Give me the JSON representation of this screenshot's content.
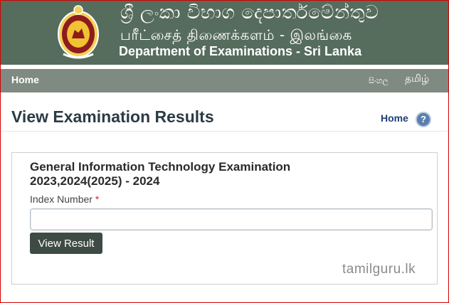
{
  "header": {
    "title_sinhala": "ශ්‍රී ලංකා විභාග දෙපාර්තමේන්තුව",
    "title_tamil": "பரீட்சைத் திணைக்களம் - இலங்கை",
    "title_english": "Department of Examinations - Sri Lanka",
    "emblem_icon": "sri-lanka-emblem-icon"
  },
  "nav": {
    "home": "Home",
    "lang_sinhala": "සිංහල",
    "lang_tamil": "தமிழ்"
  },
  "page": {
    "title": "View Examination Results",
    "breadcrumb_home": "Home",
    "help_icon_glyph": "?"
  },
  "form": {
    "exam_title": "General Information Technology Examination 2023,2024(2025) - 2024",
    "index_label": "Index Number",
    "required_marker": "*",
    "index_value": "",
    "index_placeholder": "",
    "submit_label": "View Result"
  },
  "watermark": "tamilguru.lk",
  "colors": {
    "banner_bg": "#566c5d",
    "navbar_bg": "#7f8a82",
    "button_bg": "#3d4b44",
    "link": "#1f3f78",
    "required": "#d22222"
  }
}
